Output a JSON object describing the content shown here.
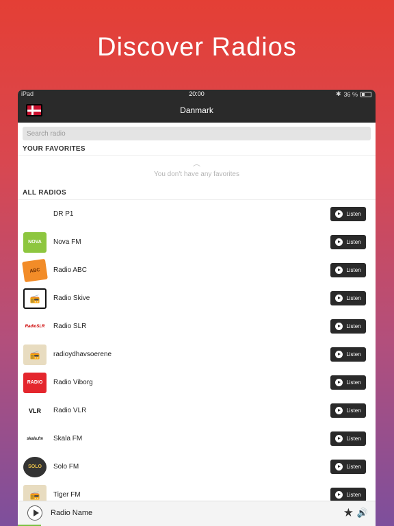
{
  "headline": "Discover Radios",
  "statusbar": {
    "device": "iPad",
    "time": "20:00",
    "battery": "36 %"
  },
  "navbar": {
    "title": "Danmark",
    "flag": "denmark-flag"
  },
  "search": {
    "placeholder": "Search radio"
  },
  "favorites": {
    "heading": "YOUR FAVORITES",
    "empty_text": "You don't have any favorites",
    "empty_icon": "︵"
  },
  "all_radios": {
    "heading": "ALL RADIOS",
    "listen_label": "Listen",
    "items": [
      {
        "name": "DR P1",
        "logo": ""
      },
      {
        "name": "Nova FM",
        "logo": "NOVA"
      },
      {
        "name": "Radio ABC",
        "logo": "ABC"
      },
      {
        "name": "Radio Skive",
        "logo": "📻"
      },
      {
        "name": "Radio SLR",
        "logo": "RadioSLR"
      },
      {
        "name": "radioydhavsoerene",
        "logo": "📻"
      },
      {
        "name": "Radio Viborg",
        "logo": "RADIO"
      },
      {
        "name": "Radio VLR",
        "logo": "VLR"
      },
      {
        "name": "Skala FM",
        "logo": "skala.fm"
      },
      {
        "name": "Solo FM",
        "logo": "SOLO"
      },
      {
        "name": "Tiger FM",
        "logo": "📻"
      }
    ]
  },
  "player": {
    "name": "Radio Name"
  },
  "colors": {
    "accent_dark": "#2a2a2a",
    "nova_green": "#8dc63f",
    "abc_orange": "#f28c28",
    "viborg_red": "#e4262d"
  }
}
